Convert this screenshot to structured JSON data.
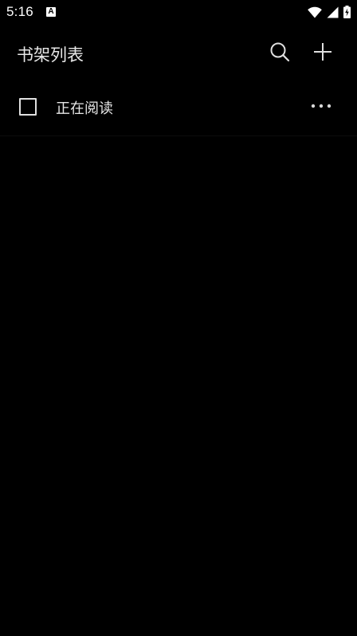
{
  "status_bar": {
    "time": "5:16",
    "notification_icon_letter": "A",
    "icons": [
      "wifi-icon",
      "cell-signal-icon",
      "battery-charging-icon"
    ]
  },
  "app_bar": {
    "title": "书架列表",
    "actions": [
      "search-icon",
      "add-icon"
    ]
  },
  "shelves": [
    {
      "label": "正在阅读",
      "checked": false,
      "menu_icon": "more-horizontal-icon"
    }
  ],
  "colors": {
    "background": "#000000",
    "text": "#e6e6e6",
    "icon": "#e0e0e0"
  }
}
